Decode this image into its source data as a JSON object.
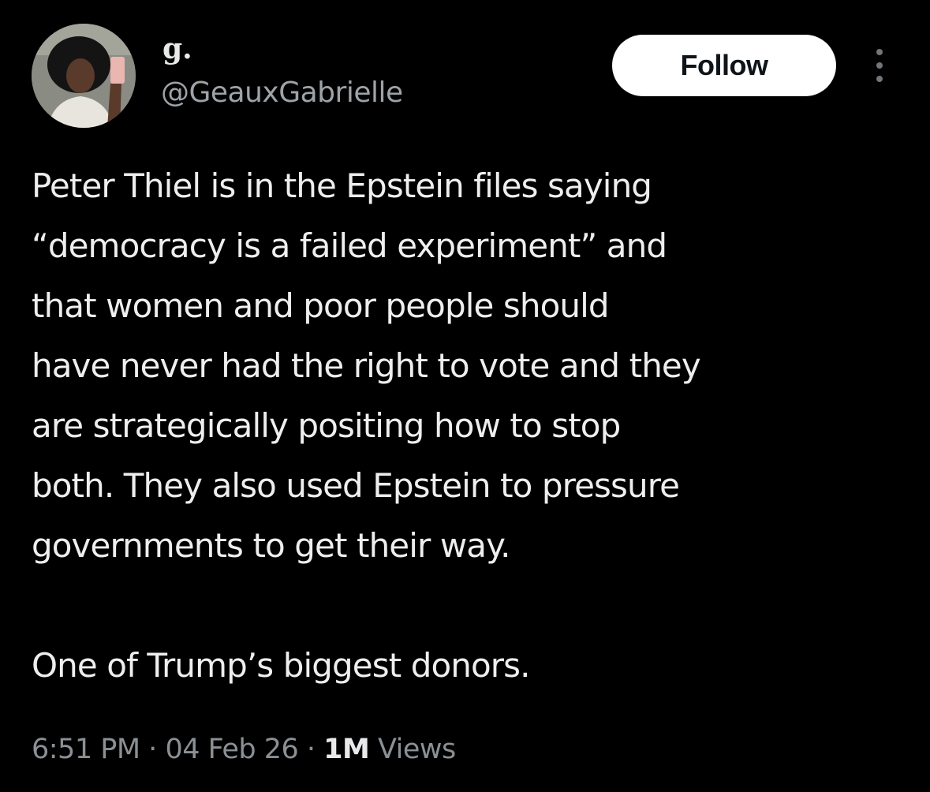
{
  "author": {
    "display_name": "g.",
    "handle": "@GeauxGabrielle"
  },
  "follow_button": {
    "label": "Follow"
  },
  "tweet": {
    "lines": [
      "Peter Thiel is in the Epstein files saying",
      "“democracy is a failed experiment” and",
      "that women and poor people should",
      "have never had the right to vote and they",
      "are strategically positing how to stop",
      "both. They also used Epstein to pressure",
      "governments to get their way."
    ],
    "closing": "One of Trump’s biggest donors."
  },
  "meta": {
    "time": "6:51 PM",
    "separator": "·",
    "date": "04 Feb 26",
    "views_count": "1M",
    "views_label": "Views"
  },
  "icons": {
    "more": "more-horizontal-icon"
  },
  "colors": {
    "background": "#000000",
    "text_primary": "#e7e9ea",
    "text_secondary": "#8b9095",
    "follow_bg": "#ffffff",
    "follow_text": "#0f1419"
  }
}
